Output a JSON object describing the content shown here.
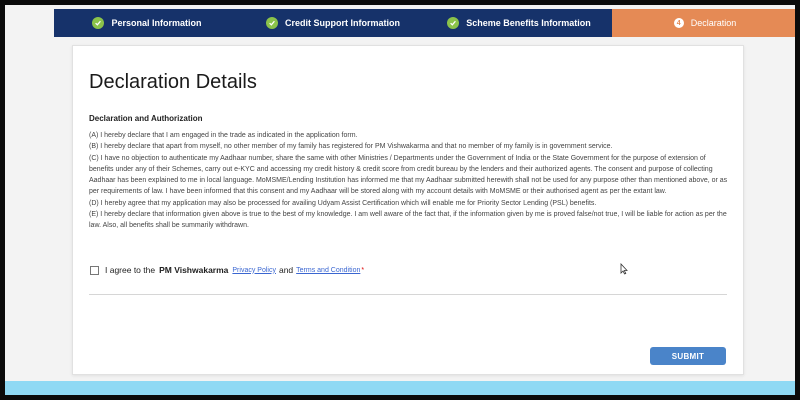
{
  "stepper": {
    "steps": [
      {
        "label": "Personal Information",
        "state": "done"
      },
      {
        "label": "Credit Support Information",
        "state": "done"
      },
      {
        "label": "Scheme Benefits Information",
        "state": "done"
      },
      {
        "label": "Declaration",
        "number": "4",
        "state": "active"
      }
    ]
  },
  "main": {
    "title": "Declaration Details",
    "subtitle": "Declaration and Authorization",
    "declarations": [
      "(A) I hereby declare that I am engaged in the trade as indicated in the application form.",
      "(B) I hereby declare that apart from myself, no other member of my family has registered for PM Vishwakarma and that no member of my family is in government service.",
      "(C) I have no objection to authenticate my Aadhaar number, share the same with other Ministries / Departments under the Government of India or the State Government for the purpose of extension of benefits under any of their Schemes, carry out e-KYC and accessing my credit history & credit score from credit bureau by the lenders and their authorized agents. The consent and purpose of collecting Aadhaar has been explained to me in local language. MoMSME/Lending Institution has informed me that my Aadhaar submitted herewith shall not be used for any purpose other than mentioned above, or as per requirements of law. I have been informed that this consent and my Aadhaar will be stored along with my account details with MoMSME or their authorised agent as per the extant law.",
      "(D) I hereby agree that my application may also be processed for availing Udyam Assist Certification which will enable me for Priority Sector Lending (PSL) benefits.",
      "(E) I hereby declare that information given above is true to the best of my knowledge. I am well aware of the fact that, if the information given by me is proved false/not true, I will be liable for action as per the law. Also, all benefits shall be summarily withdrawn."
    ],
    "agree": {
      "prefix": "I agree to the",
      "scheme": "PM Vishwakarma",
      "privacy_link": "Privacy Policy",
      "and": "and",
      "terms_link": "Terms and Condition",
      "required_mark": "*",
      "checked": false
    },
    "submit_label": "SUBMIT"
  },
  "colors": {
    "step_done": "#16326a",
    "step_active": "#e58a55",
    "check_green": "#8bc34a",
    "submit": "#4a84c9",
    "bottom_bar": "#8fd9f4"
  }
}
